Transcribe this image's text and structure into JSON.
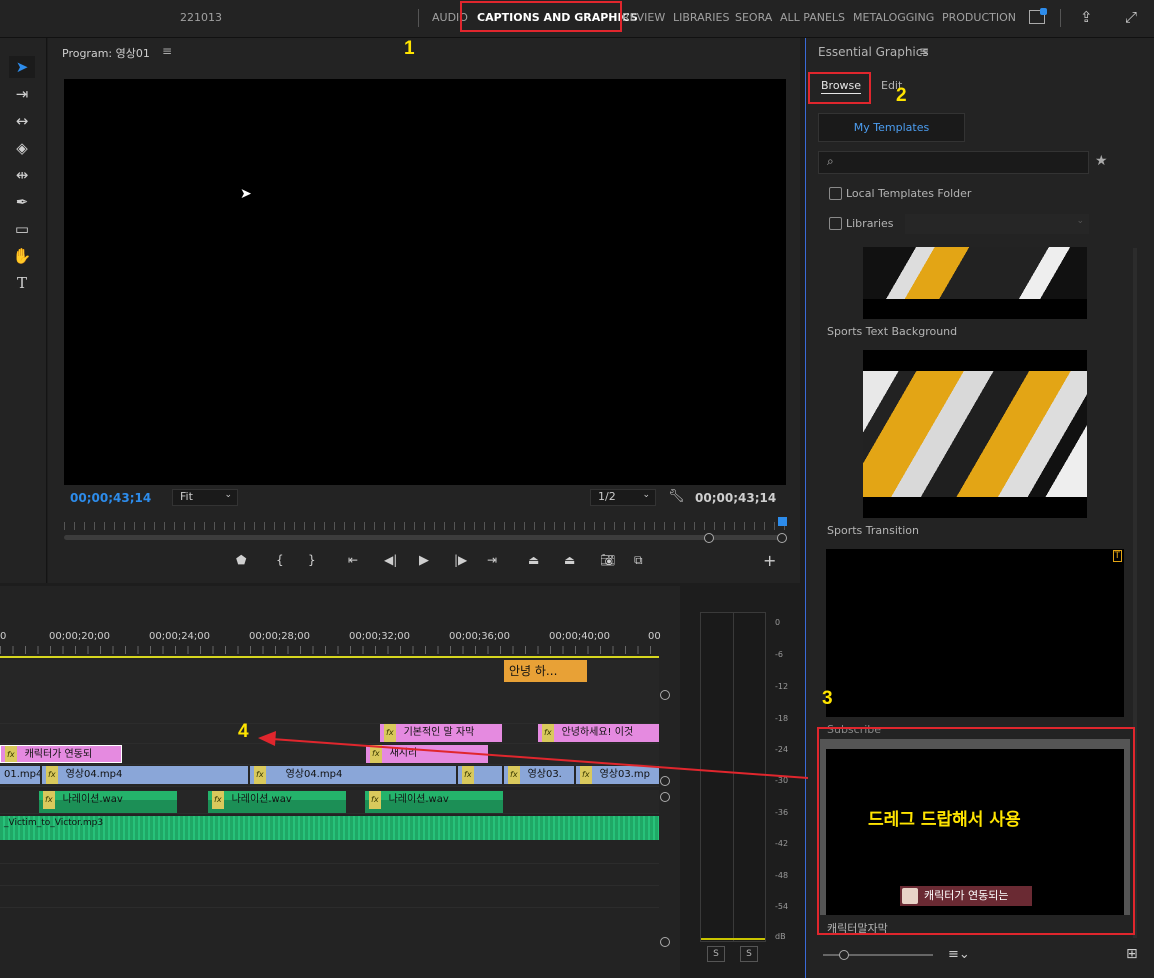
{
  "topbar": {
    "project": "221013",
    "workspaces": [
      {
        "label": "AUDIO"
      },
      {
        "label": "CAPTIONS AND GRAPHICS",
        "active": true
      },
      {
        "label": "REVIEW"
      },
      {
        "label": "LIBRARIES"
      },
      {
        "label": "SEORA"
      },
      {
        "label": "ALL PANELS"
      },
      {
        "label": "METALOGGING"
      },
      {
        "label": "PRODUCTION"
      }
    ]
  },
  "annotations": {
    "a1": "1",
    "a2": "2",
    "a3": "3",
    "a4": "4"
  },
  "program": {
    "title": "Program: 영상01",
    "timecode_left": "00;00;43;14",
    "zoom": "Fit",
    "resolution": "1/2",
    "timecode_right": "00;00;43;14"
  },
  "timeline": {
    "ruler": [
      "0",
      "00;00;20;00",
      "00;00;24;00",
      "00;00;28;00",
      "00;00;32;00",
      "00;00;36;00",
      "00;00;40;00",
      "00"
    ],
    "caption": "안녕 하...",
    "clips": {
      "g1": "기본적인 말 자막",
      "g2": "안녕하세요! 이것",
      "g3": "캐릭터가 연동되",
      "g4": "새시리",
      "v1": "01.mp4",
      "v2": "영상04.mp4",
      "v3": "영상04.mp4",
      "v4": "영상03.",
      "v5": "영상03.mp",
      "a1": "나레이션.wav",
      "a2": "나레이션.wav",
      "a3": "나레이션.wav",
      "a4": "_Victim_to_Victor.mp3"
    }
  },
  "meter": {
    "scale": [
      "0",
      "-6",
      "-12",
      "-18",
      "-24",
      "-30",
      "-36",
      "-42",
      "-48",
      "-54",
      "dB"
    ],
    "solo": "S"
  },
  "essential_graphics": {
    "title": "Essential Graphics",
    "tab_browse": "Browse",
    "tab_edit": "Edit",
    "my_templates": "My Templates",
    "search_placeholder": "",
    "local_templates": "Local Templates Folder",
    "libraries": "Libraries",
    "templates": [
      {
        "name": "Sports Text Background"
      },
      {
        "name": "Sports Transition"
      },
      {
        "name": "Subscribe"
      },
      {
        "name": "캐릭터말자막"
      }
    ],
    "preview_text": "드레그 드랍해서 사용",
    "preview_caption": "캐릭터가 연동되는"
  },
  "colors": {
    "accent": "#2d8ceb",
    "red": "#e0262d",
    "annotation": "#ffe400"
  }
}
